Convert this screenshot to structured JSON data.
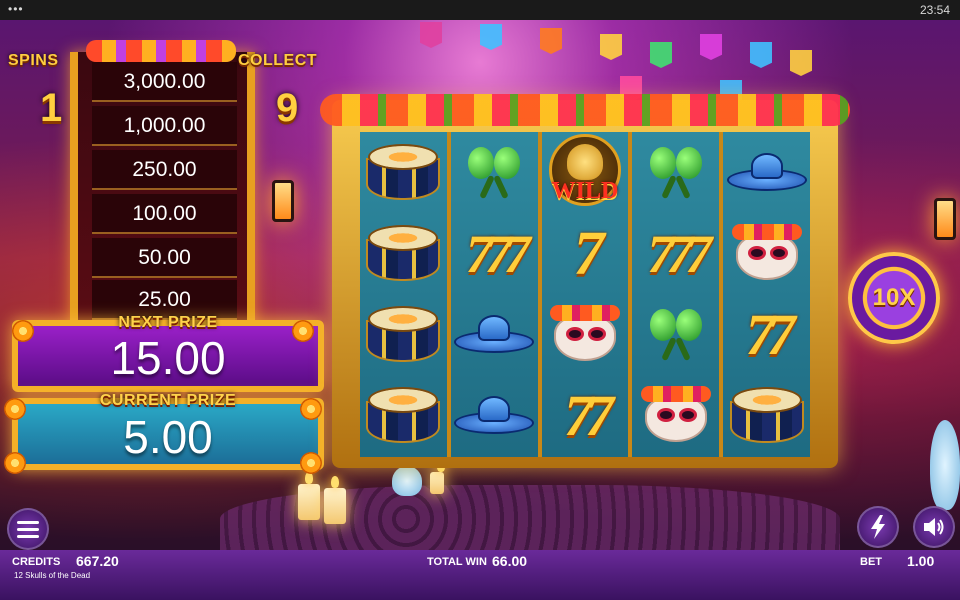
{
  "status_bar": {
    "time": "23:54",
    "menu_dots": "•••"
  },
  "ladder": {
    "spins_label": "SPINS",
    "spins_value": "1",
    "collect_label": "COLLECT",
    "collect_value": "9",
    "prizes": [
      "3,000.00",
      "1,000.00",
      "250.00",
      "100.00",
      "50.00",
      "25.00"
    ]
  },
  "next_prize": {
    "label": "NEXT PRIZE",
    "value": "15.00"
  },
  "current_prize": {
    "label": "CURRENT PRIZE",
    "value": "5.00"
  },
  "reels": {
    "wild_text": "WILD",
    "seven_single": "7",
    "seven_double": "77",
    "seven_triple": "777",
    "grid": [
      [
        "drum",
        "drum",
        "drum",
        "drum"
      ],
      [
        "maracas",
        "triple-seven",
        "sombrero",
        "sombrero"
      ],
      [
        "wild",
        "single-seven",
        "mask",
        "double-seven"
      ],
      [
        "maracas",
        "triple-seven",
        "maracas",
        "mask"
      ],
      [
        "sombrero",
        "mask",
        "double-seven",
        "drum"
      ]
    ]
  },
  "multiplier": {
    "label": "10X"
  },
  "bottom_bar": {
    "credits_label": "CREDITS",
    "credits_value": "667.20",
    "game_name": "12 Skulls of the Dead",
    "total_win_label": "TOTAL WIN",
    "total_win_value": "66.00",
    "bet_label": "BET",
    "bet_value": "1.00"
  },
  "icons": {
    "menu": "hamburger-menu-icon",
    "turbo": "lightning-icon",
    "sound": "speaker-icon"
  },
  "colors": {
    "next_prize_bg": "#7a18b0",
    "current_prize_bg": "#2090b8",
    "gold_frame": "#f4b028",
    "reel_bg": "#1e6b82",
    "bottom_bar": "#4a1a78"
  }
}
